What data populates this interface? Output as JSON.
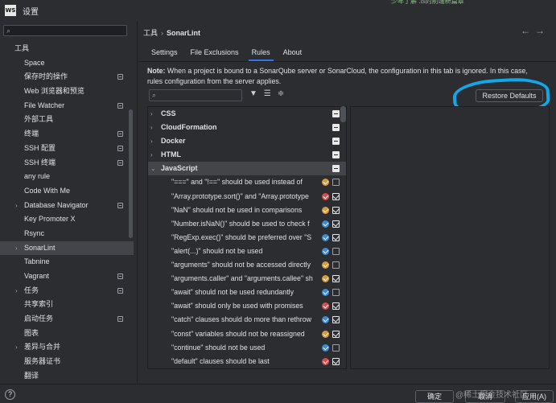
{
  "window": {
    "logo": "WS",
    "title": "设置",
    "bg_text": "少年了解 .ts的前端新篇章"
  },
  "sidebar": {
    "items": [
      {
        "label": "工具",
        "kind": "section",
        "arrow": "",
        "badge": false,
        "selected": false
      },
      {
        "label": "Space",
        "arrow": "",
        "badge": false,
        "selected": false
      },
      {
        "label": "保存时的操作",
        "arrow": "",
        "badge": true,
        "selected": false
      },
      {
        "label": "Web 浏览器和预览",
        "arrow": "",
        "badge": false,
        "selected": false
      },
      {
        "label": "File Watcher",
        "arrow": "",
        "badge": true,
        "selected": false
      },
      {
        "label": "外部工具",
        "arrow": "",
        "badge": false,
        "selected": false
      },
      {
        "label": "终端",
        "arrow": "",
        "badge": true,
        "selected": false
      },
      {
        "label": "SSH 配置",
        "arrow": "",
        "badge": true,
        "selected": false
      },
      {
        "label": "SSH 终端",
        "arrow": "",
        "badge": true,
        "selected": false
      },
      {
        "label": "any rule",
        "arrow": "",
        "badge": false,
        "selected": false
      },
      {
        "label": "Code With Me",
        "arrow": "",
        "badge": false,
        "selected": false
      },
      {
        "label": "Database Navigator",
        "arrow": "›",
        "badge": true,
        "selected": false
      },
      {
        "label": "Key Promoter X",
        "arrow": "",
        "badge": false,
        "selected": false
      },
      {
        "label": "Rsync",
        "arrow": "",
        "badge": false,
        "selected": false
      },
      {
        "label": "SonarLint",
        "arrow": "›",
        "badge": false,
        "selected": true
      },
      {
        "label": "Tabnine",
        "arrow": "",
        "badge": false,
        "selected": false
      },
      {
        "label": "Vagrant",
        "arrow": "",
        "badge": true,
        "selected": false
      },
      {
        "label": "任务",
        "arrow": "›",
        "badge": true,
        "selected": false
      },
      {
        "label": "共享索引",
        "arrow": "",
        "badge": false,
        "selected": false
      },
      {
        "label": "启动任务",
        "arrow": "",
        "badge": true,
        "selected": false
      },
      {
        "label": "图表",
        "arrow": "",
        "badge": false,
        "selected": false
      },
      {
        "label": "差异与合并",
        "arrow": "›",
        "badge": false,
        "selected": false
      },
      {
        "label": "服务器证书",
        "arrow": "",
        "badge": false,
        "selected": false
      },
      {
        "label": "翻译",
        "arrow": "",
        "badge": false,
        "selected": false
      }
    ]
  },
  "main": {
    "breadcrumb": {
      "parent": "工具",
      "separator": "›",
      "current": "SonarLint"
    },
    "tabs": [
      {
        "label": "Settings",
        "active": false
      },
      {
        "label": "File Exclusions",
        "active": false
      },
      {
        "label": "Rules",
        "active": true
      },
      {
        "label": "About",
        "active": false
      }
    ],
    "note": {
      "bold": "Note:",
      "text": " When a project is bound to a SonarQube server or SonarCloud, the configuration in this tab is ignored. In this case, rules configuration from the server applies."
    },
    "restore_button": "Restore Defaults",
    "annotation_color": "#12a7e6",
    "groups": [
      {
        "label": "CSS",
        "expanded": false
      },
      {
        "label": "CloudFormation",
        "expanded": false
      },
      {
        "label": "Docker",
        "expanded": false
      },
      {
        "label": "HTML",
        "expanded": false
      },
      {
        "label": "JavaScript",
        "expanded": true
      }
    ],
    "rules": [
      {
        "label": "\"===\" and \"!==\" should be used instead of",
        "severity": "major",
        "checked": false
      },
      {
        "label": "\"Array.prototype.sort()\" and \"Array.prototype",
        "severity": "critical",
        "checked": true
      },
      {
        "label": "\"NaN\" should not be used in comparisons",
        "severity": "major",
        "checked": true
      },
      {
        "label": "\"Number.isNaN()\" should be used to check f",
        "severity": "minor",
        "checked": true
      },
      {
        "label": "\"RegExp.exec()\" should be preferred over \"S",
        "severity": "minor",
        "checked": true
      },
      {
        "label": "\"alert(...)\" should not be used",
        "severity": "minor",
        "checked": false
      },
      {
        "label": "\"arguments\" should not be accessed directly",
        "severity": "major",
        "checked": false
      },
      {
        "label": "\"arguments.caller\" and \"arguments.callee\" sh",
        "severity": "major",
        "checked": true
      },
      {
        "label": "\"await\" should not be used redundantly",
        "severity": "minor",
        "checked": false
      },
      {
        "label": "\"await\" should only be used with promises",
        "severity": "critical",
        "checked": true
      },
      {
        "label": "\"catch\" clauses should do more than rethrow",
        "severity": "minor",
        "checked": true
      },
      {
        "label": "\"const\" variables should not be reassigned",
        "severity": "major",
        "checked": true
      },
      {
        "label": "\"continue\" should not be used",
        "severity": "minor",
        "checked": false
      },
      {
        "label": "\"default\" clauses should be last",
        "severity": "critical",
        "checked": true
      }
    ]
  },
  "footer": {
    "help": "?",
    "ok": "确定",
    "cancel": "取消",
    "apply": "应用(A)",
    "watermark": "@稀土掘金技术社区"
  }
}
